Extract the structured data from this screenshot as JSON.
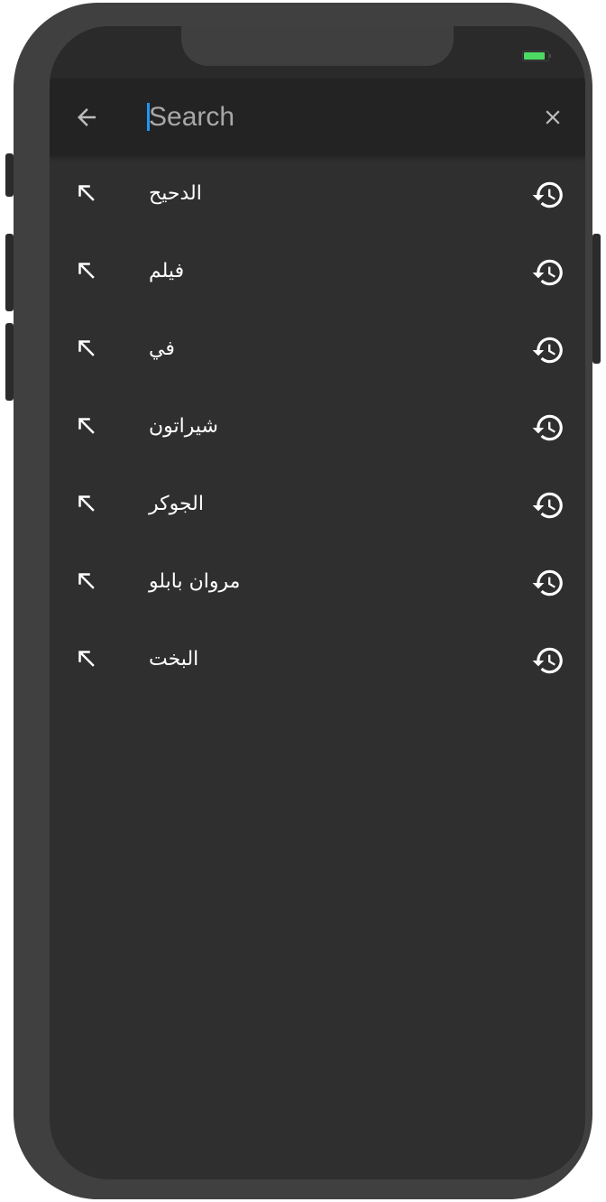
{
  "status_bar": {
    "battery_color": "#4cd964",
    "battery_level": 0.9
  },
  "search_bar": {
    "back_icon": "arrow-left-icon",
    "placeholder": "Search",
    "value": "",
    "clear_icon": "close-icon"
  },
  "suggestions": [
    {
      "text": "الدحيح",
      "fill_icon": "arrow-up-left-icon",
      "type_icon": "history-icon"
    },
    {
      "text": "فيلم",
      "fill_icon": "arrow-up-left-icon",
      "type_icon": "history-icon"
    },
    {
      "text": "في",
      "fill_icon": "arrow-up-left-icon",
      "type_icon": "history-icon"
    },
    {
      "text": "شيراتون",
      "fill_icon": "arrow-up-left-icon",
      "type_icon": "history-icon"
    },
    {
      "text": "الجوكر",
      "fill_icon": "arrow-up-left-icon",
      "type_icon": "history-icon"
    },
    {
      "text": "مروان بابلو",
      "fill_icon": "arrow-up-left-icon",
      "type_icon": "history-icon"
    },
    {
      "text": "البخت",
      "fill_icon": "arrow-up-left-icon",
      "type_icon": "history-icon"
    }
  ],
  "colors": {
    "background": "#2f2f2f",
    "appbar": "#232323",
    "caret": "#2196f3",
    "text": "#ffffff"
  }
}
